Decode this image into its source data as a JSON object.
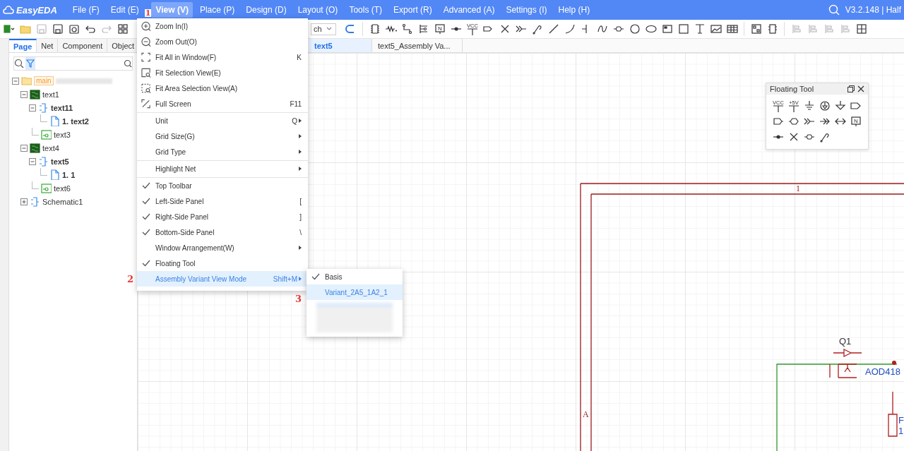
{
  "app": {
    "logo": "EasyEDA",
    "version": "V3.2.148 | Half"
  },
  "menubar": [
    {
      "label": "File (F)",
      "selected": false
    },
    {
      "label": "Edit (E)",
      "selected": false
    },
    {
      "label": "View (V)",
      "selected": true,
      "marker": "1"
    },
    {
      "label": "Place (P)",
      "selected": false
    },
    {
      "label": "Design (D)",
      "selected": false
    },
    {
      "label": "Layout (O)",
      "selected": false
    },
    {
      "label": "Tools (T)",
      "selected": false
    },
    {
      "label": "Export (R)",
      "selected": false
    },
    {
      "label": "Advanced (A)",
      "selected": false
    },
    {
      "label": "Settings (I)",
      "selected": false
    },
    {
      "label": "Help (H)",
      "selected": false
    }
  ],
  "toolbar": {
    "select_value": "ch",
    "vcc_label": "VCC",
    "netlabel_letter": "N"
  },
  "panel_tabs": [
    {
      "label": "Page",
      "selected": true
    },
    {
      "label": "Net",
      "selected": false
    },
    {
      "label": "Component",
      "selected": false
    },
    {
      "label": "Object",
      "selected": false
    }
  ],
  "tree": [
    {
      "label": "main",
      "kind": "folder",
      "expanded": true,
      "children": [
        {
          "label": "text1",
          "kind": "board",
          "expanded": true,
          "open": false,
          "children": [
            {
              "label": "text11",
              "kind": "schematic",
              "expanded": true,
              "open": true,
              "children": [
                {
                  "label": "1. text2",
                  "kind": "page",
                  "open": true
                }
              ]
            },
            {
              "label": "text3",
              "kind": "pcb",
              "open": false
            }
          ]
        },
        {
          "label": "text4",
          "kind": "board",
          "expanded": true,
          "open": false,
          "children": [
            {
              "label": "text5",
              "kind": "schematic",
              "expanded": true,
              "open": true,
              "children": [
                {
                  "label": "1. 1",
                  "kind": "page",
                  "open": true
                }
              ]
            },
            {
              "label": "text6",
              "kind": "pcb",
              "open": false
            }
          ]
        },
        {
          "label": "Schematic1",
          "kind": "schematic",
          "expanded": false,
          "open": false
        }
      ]
    }
  ],
  "doc_tabs": [
    {
      "label": "text5",
      "selected": true
    },
    {
      "label": "text5_Assembly Va...",
      "selected": false
    }
  ],
  "view_menu": {
    "items": [
      {
        "label": "Zoom In(I)",
        "kind": "command"
      },
      {
        "label": "Zoom Out(O)",
        "kind": "command"
      },
      {
        "label": "Fit All in Window(F)",
        "kind": "command",
        "shortcut": "K"
      },
      {
        "label": "Fit Selection View(E)",
        "kind": "command"
      },
      {
        "label": "Fit Area Selection View(A)",
        "kind": "command"
      },
      {
        "label": "Full Screen",
        "kind": "command",
        "shortcut": "F11"
      },
      {
        "label": "Unit",
        "kind": "submenu",
        "shortcut": "Q",
        "separator_before": true
      },
      {
        "label": "Grid Size(G)",
        "kind": "submenu"
      },
      {
        "label": "Grid Type",
        "kind": "submenu"
      },
      {
        "label": "Highlight Net",
        "kind": "submenu",
        "separator_before": true
      },
      {
        "label": "Top Toolbar",
        "kind": "toggle",
        "checked": true,
        "selected": false,
        "separator_before": true
      },
      {
        "label": "Left-Side Panel",
        "kind": "toggle",
        "shortcut": "[",
        "checked": true,
        "selected": false
      },
      {
        "label": "Right-Side Panel",
        "kind": "toggle",
        "shortcut": "]",
        "checked": true,
        "selected": false
      },
      {
        "label": "Bottom-Side Panel",
        "kind": "toggle",
        "shortcut": "\\",
        "checked": true,
        "selected": false
      },
      {
        "label": "Window Arrangement(W)",
        "kind": "submenu",
        "checked": false,
        "selected": false
      },
      {
        "label": "Floating Tool",
        "kind": "toggle",
        "checked": true,
        "selected": false
      },
      {
        "label": "Assembly Variant View Mode",
        "kind": "submenu",
        "shortcut": "Shift+M",
        "checked": false,
        "selected": true,
        "marker": "2"
      }
    ]
  },
  "variant_submenu": [
    {
      "label": "Basis",
      "checked": true,
      "selected": false
    },
    {
      "label": "Variant_2A5_1A2_1",
      "checked": false,
      "selected": true,
      "marker": "3"
    }
  ],
  "floating_tool": {
    "title": "Floating Tool",
    "vcc_label": "VCC",
    "plus5v_label": "+5V",
    "netlabel_letter": "N"
  },
  "schematic": {
    "frame_column": "1",
    "frame_row": "A",
    "designator": "Q1",
    "value": "AOD418",
    "resistor_designator": "F",
    "resistor_value": "1"
  }
}
